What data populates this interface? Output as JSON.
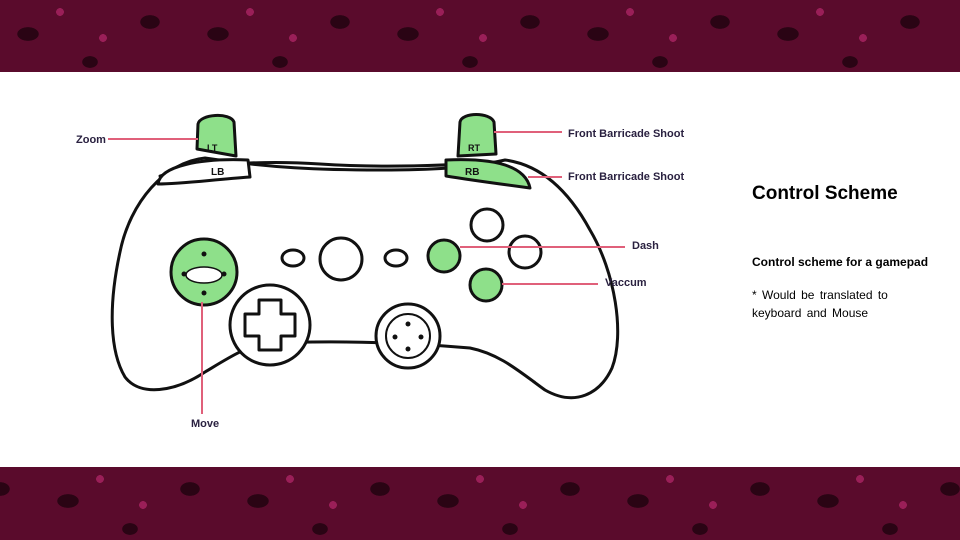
{
  "slide": {
    "title": "Control Scheme",
    "subtitle": "Control scheme for a gamepad",
    "note": "* Would be translated to keyboard and Mouse"
  },
  "diagram": {
    "labels": {
      "zoom": "Zoom",
      "rt": "Front Barricade Shoot",
      "rb": "Front Barricade Shoot",
      "dash": "Dash",
      "vaccum": "Vaccum",
      "move": "Move"
    },
    "button_text": {
      "lt": "LT",
      "rt": "RT",
      "lb": "LB",
      "rb": "RB"
    }
  },
  "colors": {
    "highlight": "#8ee08a",
    "leader_line": "#e0607a",
    "outline": "#111111",
    "background": "#5a0b2c"
  }
}
